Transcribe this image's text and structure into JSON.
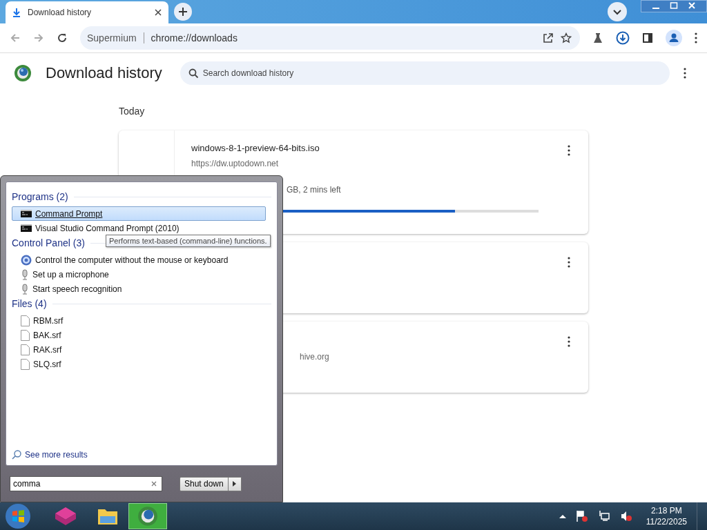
{
  "browser": {
    "tab": {
      "title": "Download history"
    },
    "address": {
      "site": "Supermium",
      "url": "chrome://downloads"
    }
  },
  "page": {
    "title": "Download history",
    "search": {
      "placeholder": "Search download history"
    },
    "date_heading": "Today",
    "downloads": [
      {
        "kind": "active",
        "filename": "windows-8-1-preview-64-bits.iso",
        "url": "https://dw.uptodown.net",
        "status": "GB, 2 mins left",
        "level": 0.76
      },
      {
        "kind": "done"
      },
      {
        "kind": "done",
        "url": "hive.org"
      }
    ]
  },
  "start_menu": {
    "groups": [
      {
        "heading": "Programs (2)",
        "items": [
          {
            "label": "Command Prompt",
            "kind": "console",
            "selected": true
          },
          {
            "label": "Visual Studio Command Prompt (2010)",
            "kind": "console",
            "selected": false
          }
        ]
      },
      {
        "heading": "Control Panel (3)",
        "items": [
          {
            "label": "Control the computer without the mouse or keyboard",
            "kind": "access",
            "selected": false
          },
          {
            "label": "Set up a microphone",
            "kind": "mic",
            "selected": false
          },
          {
            "label": "Start speech recognition",
            "kind": "mic",
            "selected": false
          }
        ]
      },
      {
        "heading": "Files (4)",
        "items": [
          {
            "label": "RBM.srf",
            "kind": "file",
            "selected": false
          },
          {
            "label": "BAK.srf",
            "kind": "file",
            "selected": false
          },
          {
            "label": "RAK.srf",
            "kind": "file",
            "selected": false
          },
          {
            "label": "SLQ.srf",
            "kind": "file",
            "selected": false
          }
        ]
      }
    ],
    "see_more": "See more results",
    "search": {
      "value": "comma"
    },
    "shutdown": "Shut down"
  },
  "tooltip": "Performs text-based (command-line) functions.",
  "taskbar": {
    "time": "2:18 PM",
    "date": "11/22/2025"
  }
}
